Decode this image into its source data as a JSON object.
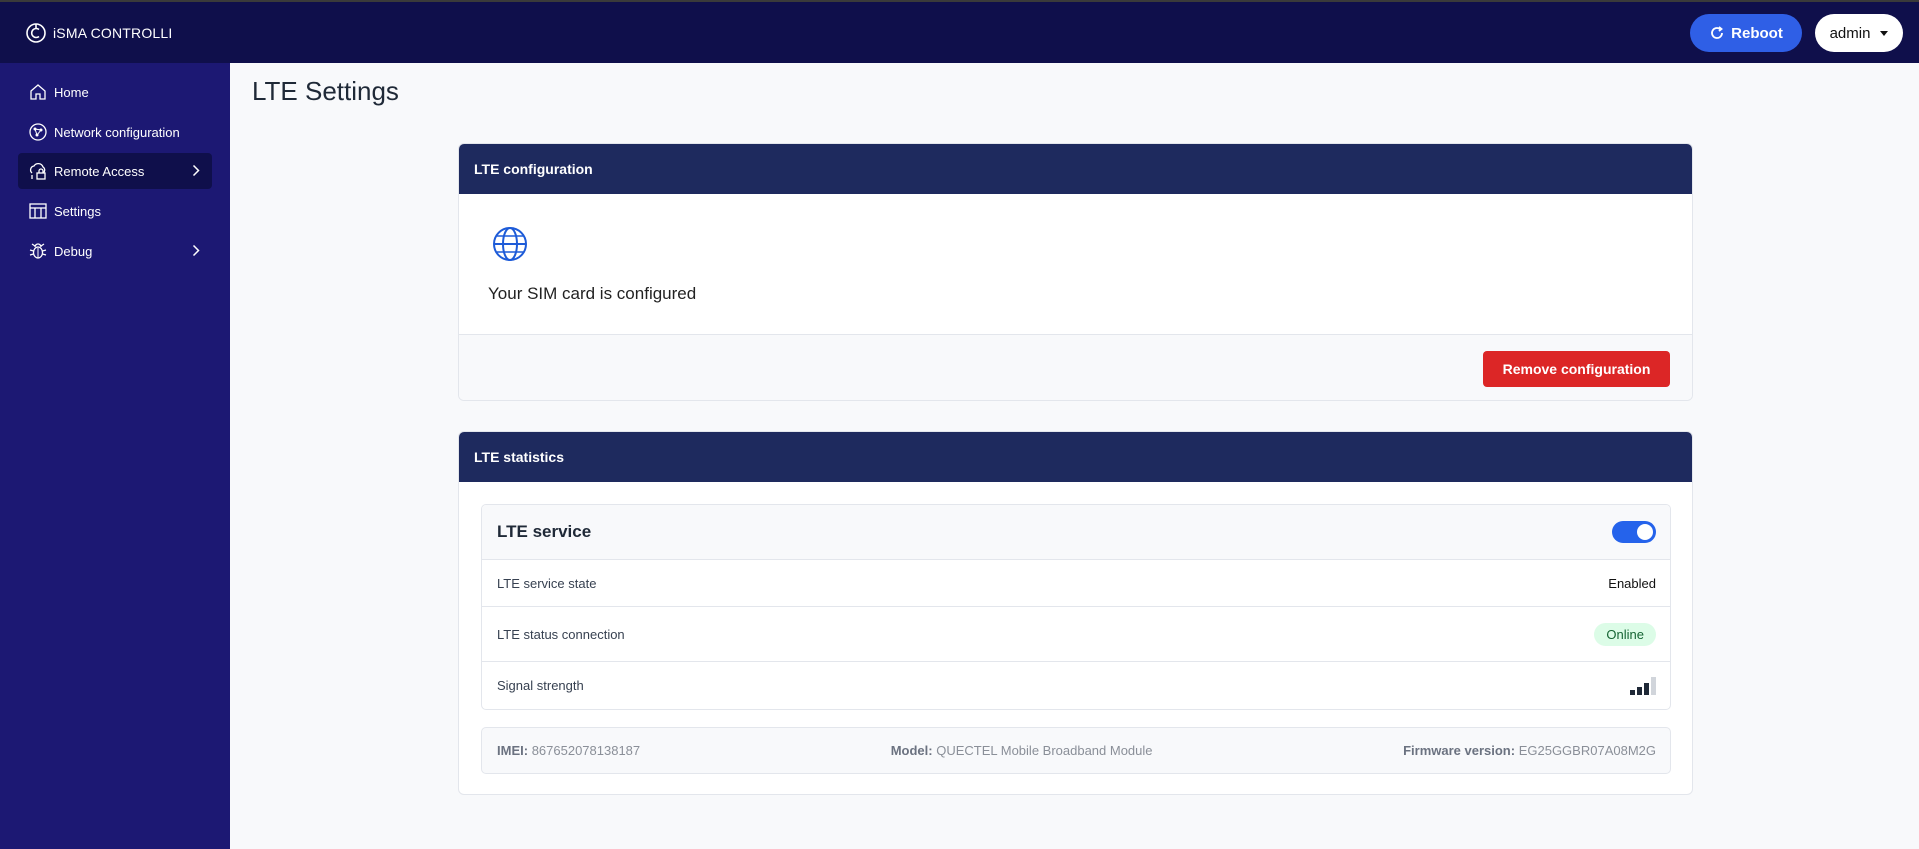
{
  "header": {
    "brand": "iSMA CONTROLLI",
    "reboot_label": "Reboot",
    "user_label": "admin"
  },
  "sidebar": {
    "items": [
      {
        "label": "Home",
        "icon": "home-icon"
      },
      {
        "label": "Network configuration",
        "icon": "network-icon"
      },
      {
        "label": "Remote Access",
        "icon": "remote-access-icon"
      },
      {
        "label": "Settings",
        "icon": "settings-icon"
      },
      {
        "label": "Debug",
        "icon": "bug-icon"
      }
    ],
    "active": "Remote Access"
  },
  "page": {
    "title": "LTE Settings"
  },
  "lte_config": {
    "header": "LTE configuration",
    "message": "Your SIM card is configured",
    "remove_label": "Remove configuration"
  },
  "lte_stats": {
    "header": "LTE statistics",
    "service_title": "LTE service",
    "service_enabled": true,
    "rows": {
      "state_label": "LTE service state",
      "state_value": "Enabled",
      "connection_label": "LTE status connection",
      "connection_value": "Online",
      "signal_label": "Signal strength",
      "signal_bars": 3,
      "signal_max": 4
    },
    "info": {
      "imei_label": "IMEI:",
      "imei_value": "867652078138187",
      "model_label": "Model:",
      "model_value": "QUECTEL Mobile Broadband Module",
      "firmware_label": "Firmware version:",
      "firmware_value": "EG25GGBR07A08M2G"
    }
  },
  "colors": {
    "topbar": "#0f0f4b",
    "sidebar": "#1c1873",
    "card_header": "#1e2a5e",
    "accent": "#2f5fe6",
    "danger": "#dc2626",
    "online_bg": "#dcfce7"
  }
}
